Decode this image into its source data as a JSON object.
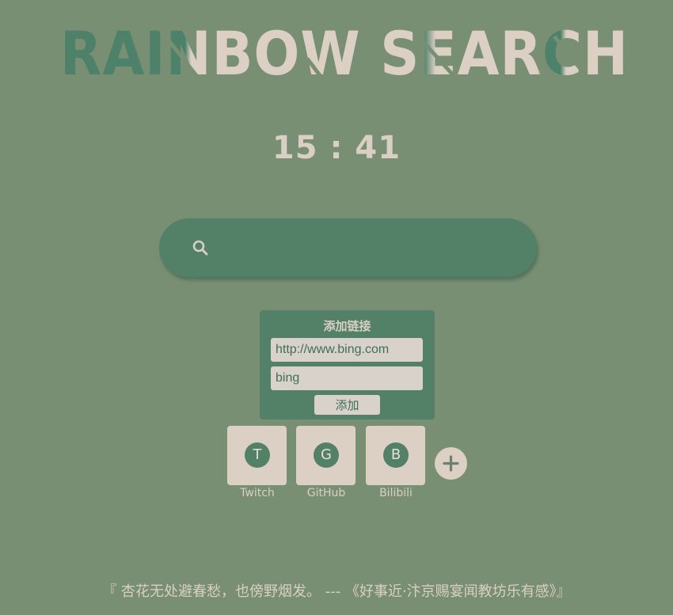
{
  "logo": {
    "text": "RAINBOW SEARCH"
  },
  "clock": {
    "time": "15 : 41"
  },
  "search": {
    "icon": "search-icon",
    "value": "",
    "placeholder": ""
  },
  "add_link": {
    "title": "添加链接",
    "url_value": "http://www.bing.com",
    "name_value": "bing",
    "button_label": "添加"
  },
  "shortcuts": [
    {
      "initial": "T",
      "label": "Twitch"
    },
    {
      "initial": "G",
      "label": "GitHub"
    },
    {
      "initial": "B",
      "label": "Bilibili"
    }
  ],
  "add_shortcut": {
    "icon": "plus-icon"
  },
  "quote": {
    "text": "『 杏花无处避春愁，也傍野烟发。 --- 《好事近·汴京赐宴闻教坊乐有感》』"
  },
  "colors": {
    "background": "#798f74",
    "accent_green": "#528168",
    "cream": "#d9cfc4"
  }
}
